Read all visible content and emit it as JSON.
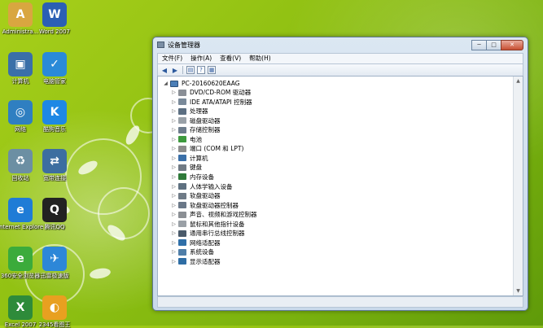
{
  "desktop": {
    "icons": [
      {
        "label": "Administra...",
        "icon": "user-folder-icon",
        "glyph": "A",
        "color": "#d9a640"
      },
      {
        "label": "Word 2007",
        "icon": "word-icon",
        "glyph": "W",
        "color": "#2b5fb4"
      },
      {
        "label": "计算机",
        "icon": "computer-icon",
        "glyph": "▣",
        "color": "#3a6fa8"
      },
      {
        "label": "电脑管家",
        "icon": "shield-icon",
        "glyph": "✓",
        "color": "#2a8ad8"
      },
      {
        "label": "网络",
        "icon": "network-icon",
        "glyph": "◎",
        "color": "#2f7fc1"
      },
      {
        "label": "酷狗音乐",
        "icon": "kugou-icon",
        "glyph": "K",
        "color": "#1e88e5"
      },
      {
        "label": "回收站",
        "icon": "recycle-bin-icon",
        "glyph": "♻",
        "color": "#6c8fa3"
      },
      {
        "label": "宽带连接",
        "icon": "broadband-icon",
        "glyph": "⇄",
        "color": "#3d6ea0"
      },
      {
        "label": "Internet Explorer",
        "icon": "ie-icon",
        "glyph": "e",
        "color": "#1f7cd6"
      },
      {
        "label": "腾讯QQ",
        "icon": "qq-icon",
        "glyph": "Q",
        "color": "#222222"
      },
      {
        "label": "360安全浏览器",
        "icon": "browser-360-icon",
        "glyph": "e",
        "color": "#3bab3b"
      },
      {
        "label": "迅雷极速版",
        "icon": "thunder-icon",
        "glyph": "✈",
        "color": "#2d87d8"
      },
      {
        "label": "Excel 2007",
        "icon": "excel-icon",
        "glyph": "X",
        "color": "#2e8b3a"
      },
      {
        "label": "2345看图王",
        "icon": "image-viewer-icon",
        "glyph": "◐",
        "color": "#e8a020"
      }
    ]
  },
  "window": {
    "title": "设备管理器",
    "controls": {
      "minimize": "─",
      "maximize": "□",
      "close": "✕"
    },
    "menu": [
      "文件(F)",
      "操作(A)",
      "查看(V)",
      "帮助(H)"
    ],
    "toolbar": {
      "back": "◀",
      "forward": "▶",
      "view": "▤",
      "help": "?",
      "properties": "▦"
    },
    "tree": {
      "root": "PC-20160620EAAG",
      "items": [
        {
          "label": "DVD/CD-ROM 驱动器",
          "icon": "dvd-drive-icon",
          "color": "#8a8f96"
        },
        {
          "label": "IDE ATA/ATAPI 控制器",
          "icon": "ide-controller-icon",
          "color": "#7a8a9a"
        },
        {
          "label": "处理器",
          "icon": "processor-icon",
          "color": "#5c6f82"
        },
        {
          "label": "磁盘驱动器",
          "icon": "disk-drive-icon",
          "color": "#9aa1a8"
        },
        {
          "label": "存储控制器",
          "icon": "storage-controller-icon",
          "color": "#6d7c8c"
        },
        {
          "label": "电池",
          "icon": "battery-icon",
          "color": "#3e9a3e"
        },
        {
          "label": "端口 (COM 和 LPT)",
          "icon": "port-icon",
          "color": "#8c8c8c"
        },
        {
          "label": "计算机",
          "icon": "computer-icon",
          "color": "#3a6fa8"
        },
        {
          "label": "键盘",
          "icon": "keyboard-icon",
          "color": "#707a84"
        },
        {
          "label": "内存设备",
          "icon": "memory-icon",
          "color": "#2f7a3a"
        },
        {
          "label": "人体学输入设备",
          "icon": "hid-icon",
          "color": "#5e7080"
        },
        {
          "label": "软盘驱动器",
          "icon": "floppy-drive-icon",
          "color": "#6f7b87"
        },
        {
          "label": "软盘驱动器控制器",
          "icon": "floppy-controller-icon",
          "color": "#6a7888"
        },
        {
          "label": "声音、视频和游戏控制器",
          "icon": "sound-icon",
          "color": "#8b8f94"
        },
        {
          "label": "鼠标和其他指针设备",
          "icon": "mouse-icon",
          "color": "#9aa0a6"
        },
        {
          "label": "通用串行总线控制器",
          "icon": "usb-icon",
          "color": "#4a5a6a"
        },
        {
          "label": "网络适配器",
          "icon": "network-adapter-icon",
          "color": "#2f6fa8"
        },
        {
          "label": "系统设备",
          "icon": "system-device-icon",
          "color": "#4f7ea8"
        },
        {
          "label": "显示适配器",
          "icon": "display-adapter-icon",
          "color": "#2e6da4"
        }
      ]
    }
  }
}
